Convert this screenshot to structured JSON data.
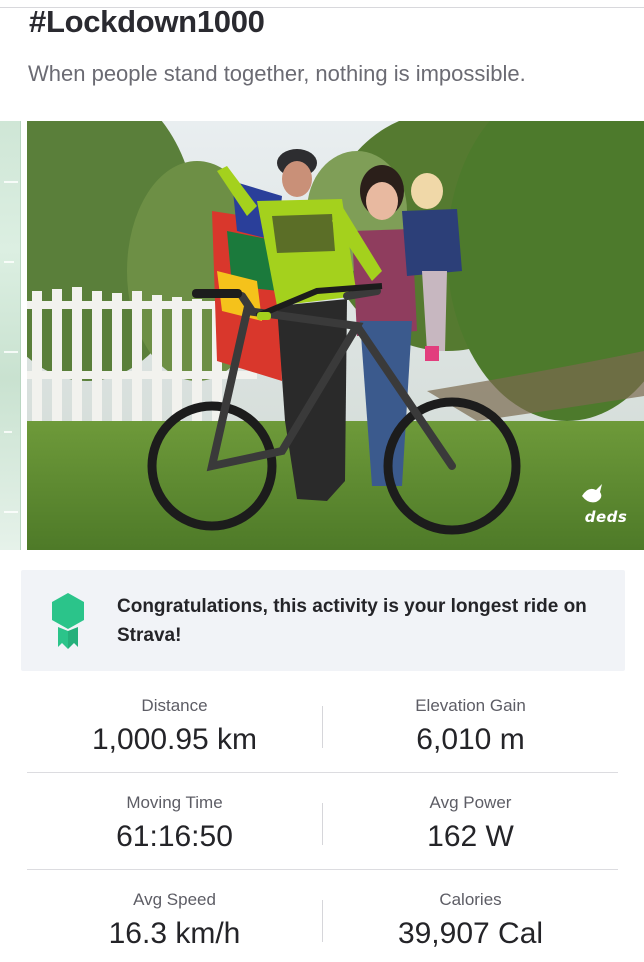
{
  "activity": {
    "title": "#Lockdown1000",
    "description": "When people stand together, nothing is impossible."
  },
  "photo": {
    "watermark_text": "deds"
  },
  "achievement": {
    "message": "Congratulations, this activity is your longest ride on Strava!",
    "icon": "achievement-ribbon-icon",
    "icon_color": "#2bc48a"
  },
  "stats": [
    {
      "left": {
        "label": "Distance",
        "value": "1,000.95 km"
      },
      "right": {
        "label": "Elevation Gain",
        "value": "6,010 m"
      }
    },
    {
      "left": {
        "label": "Moving Time",
        "value": "61:16:50"
      },
      "right": {
        "label": "Avg Power",
        "value": "162 W"
      }
    },
    {
      "left": {
        "label": "Avg Speed",
        "value": "16.3 km/h"
      },
      "right": {
        "label": "Calories",
        "value": "39,907 Cal"
      }
    }
  ]
}
